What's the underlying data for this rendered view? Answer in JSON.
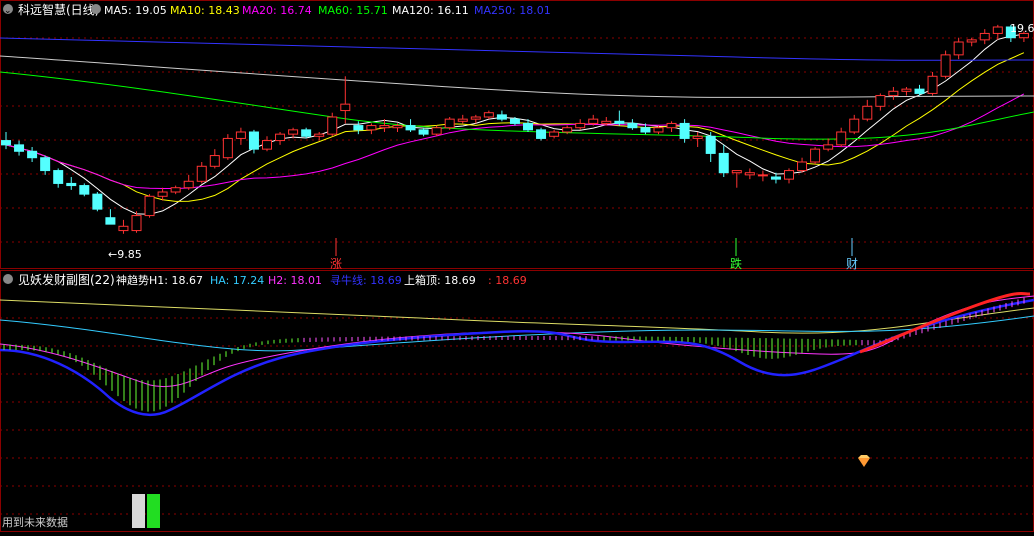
{
  "top_panel": {
    "title": "科远智慧(日线)",
    "ma_labels": [
      {
        "label": "MA5: 19.05",
        "color": "#ffffff"
      },
      {
        "label": "MA10: 18.43",
        "color": "#ffff00"
      },
      {
        "label": "MA20: 16.74",
        "color": "#ff00ff"
      },
      {
        "label": "MA60: 15.71",
        "color": "#00ff00"
      },
      {
        "label": "MA120: 16.11",
        "color": "#ffffff"
      },
      {
        "label": "MA250: 18.01",
        "color": "#3333ff"
      }
    ],
    "low_marker": "←9.85",
    "high_marker": "19.6",
    "events": [
      {
        "label": "涨",
        "color": "#ff3333"
      },
      {
        "label": "跌",
        "color": "#33ff33"
      },
      {
        "label": "财",
        "color": "#66ccff"
      }
    ]
  },
  "bottom_panel": {
    "title": "见妖发财副图(22)",
    "indicators": [
      {
        "label": "神趋势H1: 18.67",
        "color": "#ffffff"
      },
      {
        "label": "HA: 17.24",
        "color": "#33ccff"
      },
      {
        "label": "H2: 18.01",
        "color": "#ff33ff"
      },
      {
        "label": "寻牛线: 18.69",
        "color": "#3333ff"
      },
      {
        "label": "上箱顶: 18.69",
        "color": "#ffffff"
      },
      {
        "label": ": 18.69",
        "color": "#ff3333"
      }
    ],
    "footer_text": "用到未来数据"
  },
  "colors": {
    "up": "#ff3333",
    "down": "#54ffff",
    "grid": "#8b0000",
    "ma5": "#ffffff",
    "ma10": "#ffff00",
    "ma20": "#ff00ff",
    "ma60": "#00ff00",
    "ma120": "#cccccc",
    "ma250": "#3333ff"
  },
  "chart_data": {
    "type": "candlestick",
    "price_range_visible": [
      9.85,
      19.6
    ],
    "candles_ohlc": [
      [
        14.2,
        14.6,
        13.8,
        14.0
      ],
      [
        14.0,
        14.2,
        13.5,
        13.7
      ],
      [
        13.7,
        13.9,
        13.2,
        13.4
      ],
      [
        13.4,
        13.5,
        12.6,
        12.8
      ],
      [
        12.8,
        12.9,
        12.0,
        12.2
      ],
      [
        12.2,
        12.5,
        11.9,
        12.1
      ],
      [
        12.1,
        12.2,
        11.6,
        11.7
      ],
      [
        11.7,
        11.8,
        10.9,
        11.0
      ],
      [
        10.6,
        11.0,
        10.3,
        10.3
      ],
      [
        10.0,
        10.5,
        9.85,
        10.2
      ],
      [
        10.0,
        10.9,
        9.9,
        10.7
      ],
      [
        10.7,
        11.7,
        10.6,
        11.6
      ],
      [
        11.6,
        12.0,
        11.4,
        11.8
      ],
      [
        11.8,
        12.1,
        11.7,
        12.0
      ],
      [
        12.0,
        12.6,
        11.9,
        12.3
      ],
      [
        12.3,
        13.2,
        12.2,
        13.0
      ],
      [
        13.0,
        13.8,
        12.9,
        13.5
      ],
      [
        13.4,
        14.5,
        13.3,
        14.3
      ],
      [
        14.3,
        14.8,
        14.0,
        14.6
      ],
      [
        14.6,
        14.7,
        13.6,
        13.8
      ],
      [
        13.8,
        14.4,
        13.7,
        14.2
      ],
      [
        14.2,
        14.6,
        14.0,
        14.5
      ],
      [
        14.5,
        14.8,
        14.3,
        14.7
      ],
      [
        14.7,
        14.8,
        14.3,
        14.4
      ],
      [
        14.4,
        14.6,
        14.2,
        14.5
      ],
      [
        14.5,
        15.5,
        14.4,
        15.3
      ],
      [
        15.6,
        17.2,
        15.0,
        15.9
      ],
      [
        14.9,
        15.1,
        14.5,
        14.7
      ],
      [
        14.7,
        15.0,
        14.5,
        14.9
      ],
      [
        14.8,
        15.2,
        14.6,
        14.9
      ],
      [
        14.8,
        15.0,
        14.6,
        14.9
      ],
      [
        14.9,
        15.2,
        14.6,
        14.7
      ],
      [
        14.7,
        14.8,
        14.4,
        14.5
      ],
      [
        14.5,
        14.9,
        14.4,
        14.8
      ],
      [
        14.8,
        15.3,
        14.7,
        15.2
      ],
      [
        15.1,
        15.4,
        15.0,
        15.2
      ],
      [
        15.2,
        15.4,
        15.0,
        15.3
      ],
      [
        15.3,
        15.6,
        15.2,
        15.5
      ],
      [
        15.4,
        15.6,
        15.1,
        15.2
      ],
      [
        15.2,
        15.3,
        14.9,
        15.0
      ],
      [
        15.0,
        15.2,
        14.6,
        14.7
      ],
      [
        14.7,
        14.8,
        14.2,
        14.3
      ],
      [
        14.4,
        14.7,
        14.3,
        14.6
      ],
      [
        14.6,
        14.9,
        14.5,
        14.8
      ],
      [
        14.8,
        15.2,
        14.7,
        15.0
      ],
      [
        15.0,
        15.4,
        14.9,
        15.2
      ],
      [
        15.0,
        15.3,
        14.9,
        15.1
      ],
      [
        15.1,
        15.6,
        14.9,
        15.0
      ],
      [
        15.0,
        15.2,
        14.7,
        14.8
      ],
      [
        14.8,
        15.0,
        14.5,
        14.6
      ],
      [
        14.6,
        14.9,
        14.5,
        14.8
      ],
      [
        14.8,
        15.1,
        14.6,
        15.0
      ],
      [
        15.0,
        15.2,
        14.1,
        14.3
      ],
      [
        14.3,
        14.6,
        13.9,
        14.4
      ],
      [
        14.4,
        14.6,
        13.2,
        13.6
      ],
      [
        13.6,
        14.0,
        12.5,
        12.7
      ],
      [
        12.7,
        12.8,
        12.0,
        12.8
      ],
      [
        12.6,
        12.9,
        12.4,
        12.7
      ],
      [
        12.6,
        12.8,
        12.3,
        12.6
      ],
      [
        12.5,
        12.7,
        12.2,
        12.4
      ],
      [
        12.4,
        12.9,
        12.2,
        12.8
      ],
      [
        12.8,
        13.4,
        12.7,
        13.2
      ],
      [
        13.2,
        13.9,
        13.1,
        13.8
      ],
      [
        13.8,
        14.3,
        13.7,
        14.0
      ],
      [
        14.0,
        14.8,
        13.9,
        14.6
      ],
      [
        14.6,
        15.4,
        14.5,
        15.2
      ],
      [
        15.2,
        16.1,
        15.1,
        15.8
      ],
      [
        15.8,
        16.4,
        15.6,
        16.3
      ],
      [
        16.3,
        16.7,
        16.1,
        16.5
      ],
      [
        16.5,
        16.7,
        16.3,
        16.6
      ],
      [
        16.6,
        16.8,
        16.3,
        16.4
      ],
      [
        16.4,
        17.4,
        16.3,
        17.2
      ],
      [
        17.2,
        18.4,
        17.1,
        18.2
      ],
      [
        18.2,
        19.0,
        18.0,
        18.8
      ],
      [
        18.8,
        19.0,
        18.6,
        18.9
      ],
      [
        18.9,
        19.4,
        18.7,
        19.2
      ],
      [
        19.2,
        19.6,
        18.9,
        19.5
      ],
      [
        19.5,
        19.6,
        18.8,
        19.0
      ],
      [
        19.0,
        19.3,
        18.8,
        19.2
      ]
    ],
    "sub_indicator_lines": [
      "神趋势H1",
      "HA",
      "H2",
      "寻牛线",
      "上箱顶"
    ]
  }
}
